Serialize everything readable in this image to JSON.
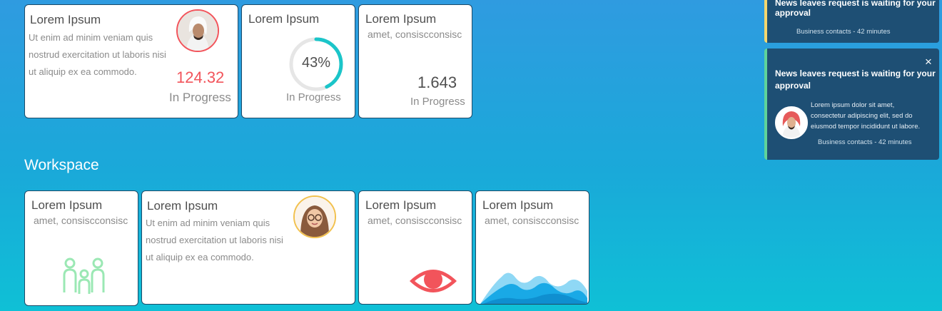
{
  "top_cards": [
    {
      "title": "Lorem Ipsum",
      "text_lines": [
        "Ut enim ad minim veniam quis",
        "nostrud exercitation ut laboris nisi",
        "ut aliquip ex ea commodo."
      ],
      "value": "124.32",
      "value_color": "#f2545b",
      "status": "In Progress"
    },
    {
      "title": "Lorem Ipsum",
      "progress_label": "43%",
      "progress_fraction": 0.43,
      "status": "In Progress"
    },
    {
      "title": "Lorem Ipsum",
      "subtitle": "amet, consiscconsisc",
      "value": "1.643",
      "status": "In Progress"
    }
  ],
  "workspace": {
    "heading": "Workspace",
    "cards": [
      {
        "title": "Lorem Ipsum",
        "subtitle": "amet, consiscconsisc",
        "icon": "family-icon"
      },
      {
        "title": "Lorem Ipsum",
        "text_lines": [
          "Ut enim ad minim veniam quis",
          "nostrud exercitation ut laboris nisi",
          "ut aliquip ex ea commodo."
        ],
        "avatar": "avatar-woman"
      },
      {
        "title": "Lorem Ipsum",
        "subtitle": "amet, consiscconsisc",
        "icon": "eye-icon"
      },
      {
        "title": "Lorem Ipsum",
        "subtitle": "amet, consiscconsisc",
        "icon": "area-chart-icon"
      }
    ]
  },
  "notifications": [
    {
      "title_lines": [
        "News leaves request is waiting for your",
        "approval"
      ],
      "meta": "Business contacts - 42 minutes",
      "accent": "#f5d76e"
    },
    {
      "title_lines": [
        "News leaves request is waiting for your",
        "approval"
      ],
      "body_lines": [
        "Lorem ipsum dolor sit amet,",
        "consectetur adipiscing elit, sed do",
        "eiusmod tempor incididunt ut labore."
      ],
      "meta": "Business contacts - 42 minutes",
      "accent": "#5fd39a",
      "close_label": "×"
    }
  ],
  "colors": {
    "accent_red": "#f2545b",
    "progress_teal": "#1bc5c9",
    "icon_green": "#9be8b4",
    "chart_blue": "#19a9e6"
  }
}
